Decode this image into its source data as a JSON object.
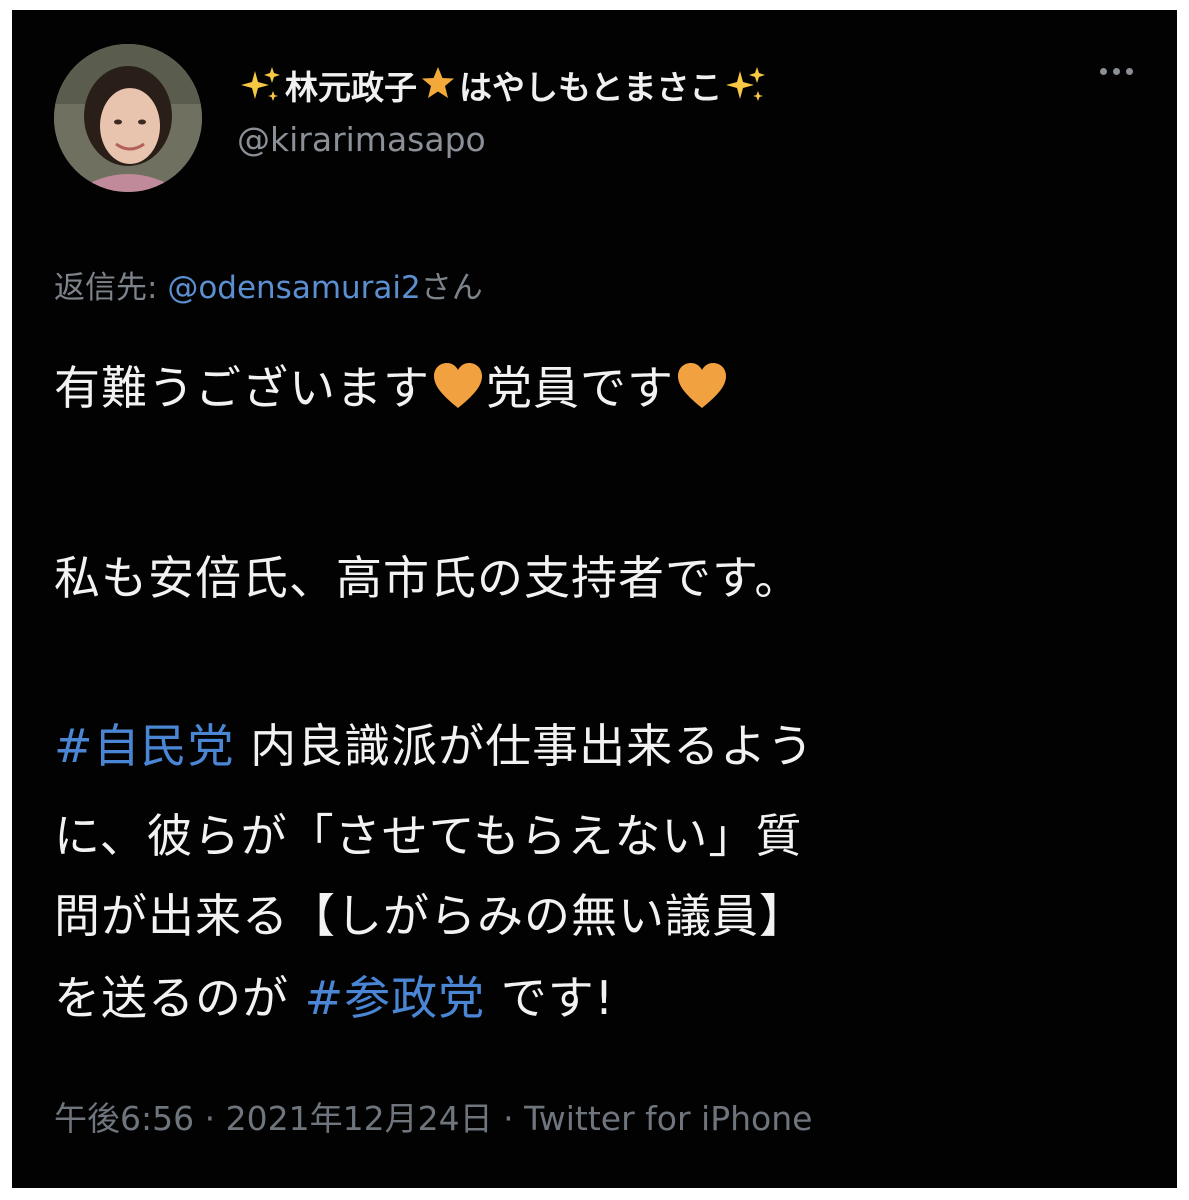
{
  "author": {
    "display_name_part1": "林元政子",
    "display_name_part2": "はやしもとまさこ",
    "handle": "@kirarimasapo"
  },
  "reply": {
    "prefix": "返信先:",
    "user": "@odensamurai2",
    "suffix": "さん"
  },
  "body": {
    "line1_a": "有難うございます",
    "line1_b": "党員です",
    "line2": "私も安倍氏、高市氏の支持者です。",
    "hashtag1": "#自民党",
    "line3_rest": "内良識派が仕事出来るよう",
    "line4": "に、彼らが「させてもらえない」質",
    "line5": "問が出来る【しがらみの無い議員】",
    "line6_a": "を送るのが",
    "hashtag2": "#参政党",
    "line6_b": "です!"
  },
  "meta": {
    "time": "午後6:56",
    "separator1": "·",
    "date": "2021年12月24日",
    "separator2": "·",
    "source": "Twitter for iPhone"
  },
  "icons": {
    "sparkle": "sparkles-icon",
    "star": "star-icon",
    "heart": "orange-heart-icon",
    "more": "more-icon"
  },
  "colors": {
    "background": "#020203",
    "text": "#f2f2f2",
    "muted": "#8b9097",
    "link": "#4a86d4",
    "heart": "#f2a140",
    "sparkle": "#f7c843"
  }
}
